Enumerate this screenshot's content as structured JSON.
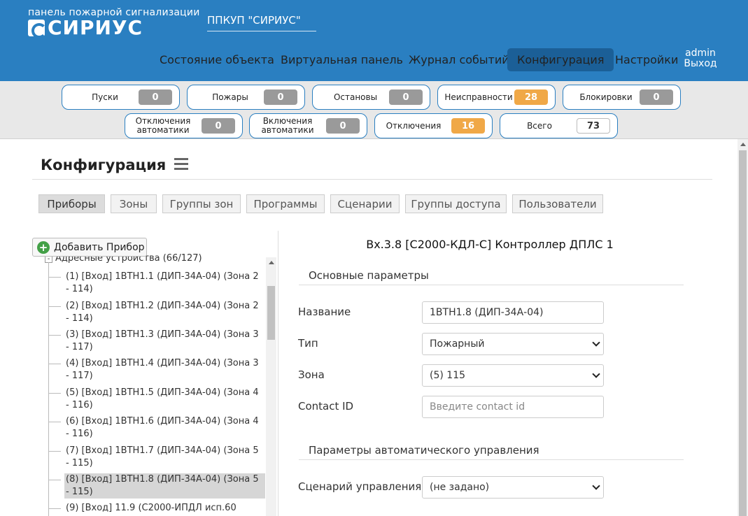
{
  "header": {
    "tagline": "панель пожарной сигнализации",
    "brand": "СИРИУС",
    "device_title": "ППКУП \"СИРИУС\"",
    "nav": [
      {
        "label": "Состояние объекта"
      },
      {
        "label": "Виртуальная панель"
      },
      {
        "label": "Журнал событий"
      },
      {
        "label": "Конфигурация",
        "active": true
      },
      {
        "label": "Настройки"
      }
    ],
    "user": "admin",
    "logout": "Выход"
  },
  "counters": [
    {
      "label": "Пуски",
      "value": "0",
      "status": "normal"
    },
    {
      "label": "Пожары",
      "value": "0",
      "status": "normal"
    },
    {
      "label": "Остановы",
      "value": "0",
      "status": "normal"
    },
    {
      "label": "Неисправности",
      "value": "28",
      "status": "warning"
    },
    {
      "label": "Блокировки",
      "value": "0",
      "status": "normal"
    },
    {
      "label": "Отключения автоматики",
      "value": "0",
      "status": "normal"
    },
    {
      "label": "Включения автоматики",
      "value": "0",
      "status": "normal"
    },
    {
      "label": "Отключения",
      "value": "16",
      "status": "warning"
    },
    {
      "label": "Всего",
      "value": "73",
      "status": "total"
    }
  ],
  "colors": {
    "header_bg": "#2a7fc1",
    "nav_active_bg": "#1b5f97",
    "counter_normal": "#9a9a9a",
    "counter_warning": "#f0a847",
    "add_icon": "#43a047"
  },
  "page": {
    "title": "Конфигурация",
    "menu_icon": "hamburger-icon",
    "tabs": [
      {
        "label": "Приборы",
        "active": true
      },
      {
        "label": "Зоны"
      },
      {
        "label": "Группы зон"
      },
      {
        "label": "Программы"
      },
      {
        "label": "Сценарии"
      },
      {
        "label": "Группы доступа"
      },
      {
        "label": "Пользователи"
      }
    ]
  },
  "tree": {
    "add_button": "Добавить Прибор",
    "add_icon": "plus-circle-icon",
    "root": "Адресные устройства (66/127)",
    "items": [
      {
        "text": "(1) [Вход] 1ВТН1.1 (ДИП-34А-04) (Зона 2 - 114)"
      },
      {
        "text": "(2) [Вход] 1ВТН1.2 (ДИП-34А-04) (Зона 2 - 114)"
      },
      {
        "text": "(3) [Вход] 1ВТН1.3 (ДИП-34А-04) (Зона 3 - 117)"
      },
      {
        "text": "(4) [Вход] 1ВТН1.4 (ДИП-34А-04) (Зона 3 - 117)"
      },
      {
        "text": "(5) [Вход] 1ВТН1.5 (ДИП-34А-04) (Зона 4 - 116)"
      },
      {
        "text": "(6) [Вход] 1ВТН1.6 (ДИП-34А-04) (Зона 4 - 116)"
      },
      {
        "text": "(7) [Вход] 1ВТН1.7 (ДИП-34А-04) (Зона 5 - 115)"
      },
      {
        "text": "(8) [Вход] 1ВТН1.8 (ДИП-34А-04) (Зона 5 - 115)",
        "selected": true
      },
      {
        "text": "(9) [Вход] 11.9 (С2000-ИПДЛ исп.60"
      }
    ]
  },
  "form": {
    "heading": "Вх.3.8 [С2000-КДЛ-С] Контроллер ДПЛС 1",
    "section_main": "Основные параметры",
    "name_label": "Название",
    "name_value": "1ВТН1.8 (ДИП-34А-04)",
    "type_label": "Тип",
    "type_value": "Пожарный",
    "zone_label": "Зона",
    "zone_value": "(5) 115",
    "contact_label": "Contact ID",
    "contact_placeholder": "Введите contact id",
    "section_auto": "Параметры автоматического управления",
    "scenario_label": "Сценарий управления",
    "scenario_value": "(не задано)"
  }
}
